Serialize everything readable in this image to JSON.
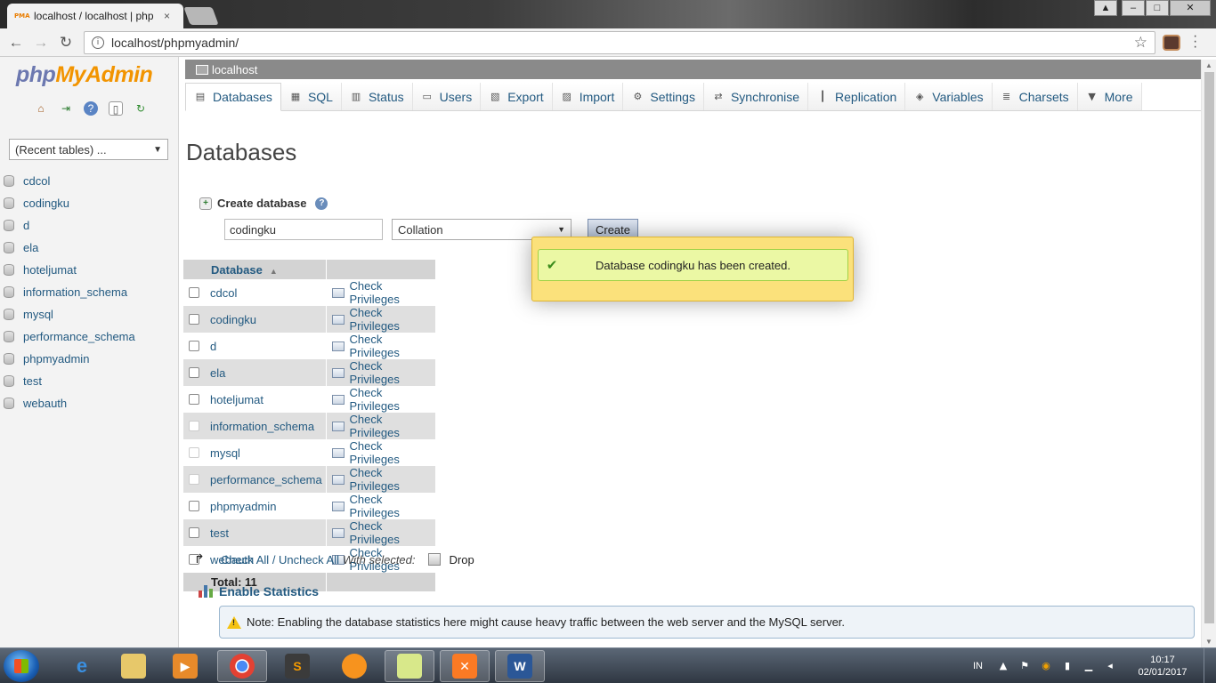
{
  "browser": {
    "tab_title": "localhost / localhost | php",
    "tab_favicon": "PMA",
    "tab_close": "×",
    "url": "localhost/phpmyadmin/"
  },
  "sidebar": {
    "logo_php": "php",
    "logo_myadmin": "MyAdmin",
    "recent_tables": "(Recent tables) ...",
    "databases": [
      "cdcol",
      "codingku",
      "d",
      "ela",
      "hoteljumat",
      "information_schema",
      "mysql",
      "performance_schema",
      "phpmyadmin",
      "test",
      "webauth"
    ]
  },
  "server": {
    "name": "localhost"
  },
  "tabs": [
    {
      "label": "Databases",
      "icon": "database-icon",
      "glyph": "▤"
    },
    {
      "label": "SQL",
      "icon": "sql-icon",
      "glyph": "▦"
    },
    {
      "label": "Status",
      "icon": "status-icon",
      "glyph": "▥"
    },
    {
      "label": "Users",
      "icon": "users-icon",
      "glyph": "▭"
    },
    {
      "label": "Export",
      "icon": "export-icon",
      "glyph": "▧"
    },
    {
      "label": "Import",
      "icon": "import-icon",
      "glyph": "▨"
    },
    {
      "label": "Settings",
      "icon": "wrench-icon",
      "glyph": "⚙"
    },
    {
      "label": "Synchronise",
      "icon": "synchronise-icon",
      "glyph": "⇄"
    },
    {
      "label": "Replication",
      "icon": "replication-icon",
      "glyph": "┃"
    },
    {
      "label": "Variables",
      "icon": "variables-icon",
      "glyph": "◈"
    },
    {
      "label": "Charsets",
      "icon": "charsets-icon",
      "glyph": "≣"
    },
    {
      "label": "More",
      "icon": "chevron-down-icon",
      "glyph": "▼"
    }
  ],
  "main": {
    "page_title": "Databases",
    "create_db_label": "Create database",
    "db_name_value": "codingku",
    "collation_value": "Collation",
    "create_button": "Create",
    "table": {
      "header_database": "Database",
      "rows": [
        {
          "name": "cdcol",
          "privileges": "Check Privileges"
        },
        {
          "name": "codingku",
          "privileges": "Check Privileges"
        },
        {
          "name": "d",
          "privileges": "Check Privileges"
        },
        {
          "name": "ela",
          "privileges": "Check Privileges"
        },
        {
          "name": "hoteljumat",
          "privileges": "Check Privileges"
        },
        {
          "name": "information_schema",
          "privileges": "Check Privileges"
        },
        {
          "name": "mysql",
          "privileges": "Check Privileges"
        },
        {
          "name": "performance_schema",
          "privileges": "Check Privileges"
        },
        {
          "name": "phpmyadmin",
          "privileges": "Check Privileges"
        },
        {
          "name": "test",
          "privileges": "Check Privileges"
        },
        {
          "name": "webauth",
          "privileges": "Check Privileges"
        }
      ],
      "total_label": "Total: 11"
    },
    "check_all": "Check All",
    "separator": " / ",
    "uncheck_all": "Uncheck All",
    "with_selected": "With selected:",
    "drop_label": "Drop",
    "enable_statistics": "Enable Statistics",
    "stats_note": "Note: Enabling the database statistics here might cause heavy traffic between the web server and the MySQL server."
  },
  "toast": {
    "message": "Database codingku has been created."
  },
  "taskbar": {
    "language": "IN",
    "time": "10:17",
    "date": "02/01/2017"
  },
  "colors": {
    "link": "#235a81",
    "toast_bg": "#fbe17b",
    "toast_inner": "#ebf8a4",
    "logo_php": "#6c78b0",
    "logo_myadmin": "#f29400"
  }
}
